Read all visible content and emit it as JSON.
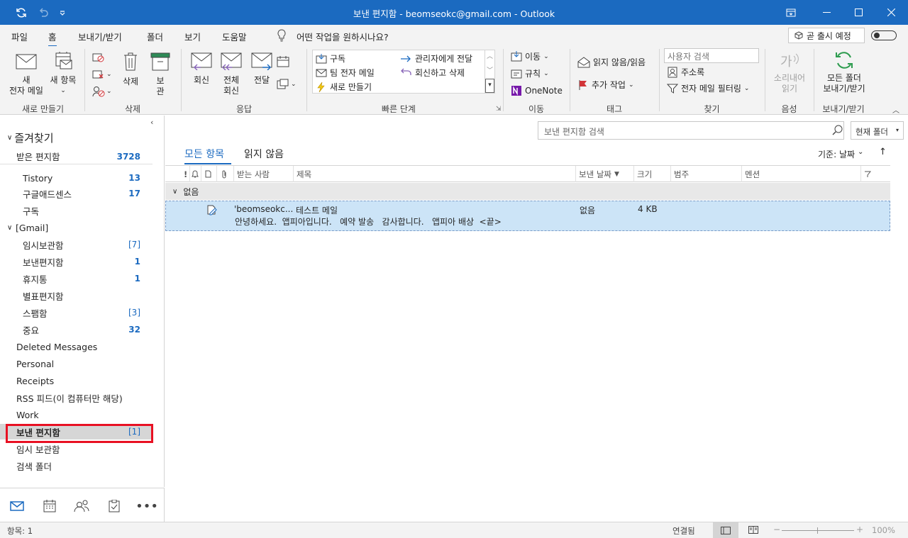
{
  "titlebar": {
    "title": "보낸 편지함 - beomseokc@gmail.com  -  Outlook"
  },
  "menu": {
    "tabs": [
      "파일",
      "홈",
      "보내기/받기",
      "폴더",
      "보기",
      "도움말"
    ],
    "tell_me": "어떤 작업을 원하시나요?",
    "coming_soon": "곧 출시 예정"
  },
  "ribbon": {
    "new_email": "새\n전자 메일",
    "new_items": "새 항목",
    "delete": "삭제",
    "archive": "보\n관",
    "reply": "회신",
    "reply_all": "전체\n회신",
    "forward": "전달",
    "quick_steps": [
      "구독",
      "팀 전자 메일",
      "새로 만들기",
      "관리자에게 전달",
      "회신하고 삭제"
    ],
    "move": "이동",
    "rules": "규칙",
    "onenote": "OneNote",
    "unread_read": "읽지 않음/읽음",
    "followup": "추가 작업",
    "search_people": "사용자 검색",
    "address_book": "주소록",
    "filter_email": "전자 메일 필터링",
    "read_aloud": "소리내어\n읽기",
    "send_receive_all": "모든 폴더\n보내기/받기",
    "groups": [
      "새로 만들기",
      "삭제",
      "응답",
      "빠른 단계",
      "이동",
      "태그",
      "찾기",
      "음성",
      "보내기/받기"
    ]
  },
  "sidebar": {
    "favorites": "즐겨찾기",
    "folders": [
      {
        "name": "받은 편지함",
        "count": "3728",
        "style": "bold",
        "indent": 0
      },
      {
        "name": "Tistory",
        "count": "13",
        "style": "bold",
        "indent": 1
      },
      {
        "name": "구글애드센스",
        "count": "17",
        "style": "bold",
        "indent": 1
      },
      {
        "name": "구독",
        "count": "",
        "style": "",
        "indent": 1
      },
      {
        "name": "[Gmail]",
        "count": "",
        "style": "",
        "indent": -1
      },
      {
        "name": "임시보관함",
        "count": "[7]",
        "style": "brk",
        "indent": 1
      },
      {
        "name": "보낸편지함",
        "count": "1",
        "style": "bold",
        "indent": 1
      },
      {
        "name": "휴지통",
        "count": "1",
        "style": "bold",
        "indent": 1
      },
      {
        "name": "별표편지함",
        "count": "",
        "style": "",
        "indent": 1
      },
      {
        "name": "스팸함",
        "count": "[3]",
        "style": "brk",
        "indent": 1
      },
      {
        "name": "중요",
        "count": "32",
        "style": "bold",
        "indent": 1
      },
      {
        "name": "Deleted Messages",
        "count": "",
        "style": "",
        "indent": 0
      },
      {
        "name": "Personal",
        "count": "",
        "style": "",
        "indent": 0
      },
      {
        "name": "Receipts",
        "count": "",
        "style": "",
        "indent": 0
      },
      {
        "name": "RSS 피드(이 컴퓨터만 해당)",
        "count": "",
        "style": "",
        "indent": 0
      },
      {
        "name": "Work",
        "count": "",
        "style": "",
        "indent": 0
      },
      {
        "name": "보낸 편지함",
        "count": "[1]",
        "style": "brk",
        "indent": 0,
        "selected": true
      },
      {
        "name": "임시 보관함",
        "count": "",
        "style": "",
        "indent": 0
      },
      {
        "name": "검색 폴더",
        "count": "",
        "style": "",
        "indent": 0
      }
    ]
  },
  "main": {
    "search_placeholder": "보낸 편지함 검색",
    "scope": "현재 폴더",
    "view_all": "모든 항목",
    "view_unread": "읽지 않음",
    "sort_by": "기준: 날짜",
    "columns": {
      "to": "받는 사람",
      "subject": "제목",
      "sent": "보낸 날짜",
      "size": "크기",
      "category": "범주",
      "mention": "멘션"
    },
    "group_label": "없음",
    "message": {
      "to": "'beomseokc...",
      "subject": "테스트 메일",
      "preview": "안녕하세요.  앱피아입니다.   예약 발송   감사합니다.   앱피아 배상  <끝>",
      "date": "없음",
      "size": "4 KB"
    }
  },
  "status": {
    "items": "항목: 1",
    "connected": "연결됨",
    "zoom": "100%"
  },
  "colors": {
    "accent": "#1b6ac0",
    "selected_row": "#cce4f7",
    "highlight_box": "#e81123"
  }
}
